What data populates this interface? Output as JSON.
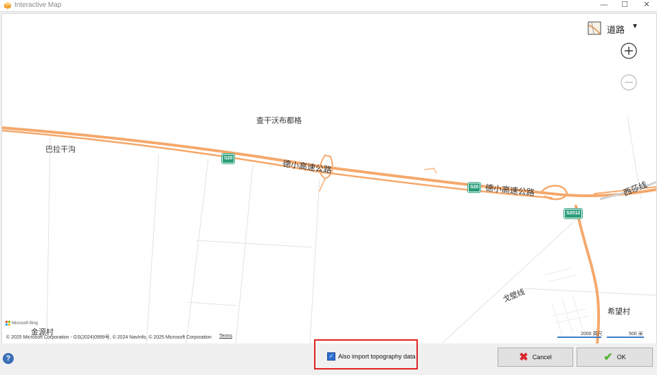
{
  "window": {
    "title": "Interactive Map",
    "minimize": "—",
    "maximize": "☐",
    "close": "✕"
  },
  "map": {
    "map_type_label": "道路",
    "places": [
      {
        "id": "chagan",
        "text": "查干沃布都格"
      },
      {
        "id": "bala",
        "text": "巴拉干沟"
      },
      {
        "id": "jinyuan",
        "text": "金源村"
      },
      {
        "id": "xiwang",
        "text": "希望村"
      }
    ],
    "roads": [
      {
        "id": "dexiao1",
        "text": "德小高速公路"
      },
      {
        "id": "dexiao2",
        "text": "德小高速公路"
      },
      {
        "id": "xisha",
        "text": "西莎线"
      },
      {
        "id": "gebi",
        "text": "戈壁线"
      }
    ],
    "shields": [
      {
        "id": "s20a",
        "text": "S20"
      },
      {
        "id": "s20b",
        "text": "S20"
      },
      {
        "id": "s2012",
        "text": "S2012"
      }
    ],
    "copyright": "© 2025 Microsoft Corporation - GS(2024)0999号, © 2024 NavInfo, © 2025 Microsoft Corporation",
    "terms": "Terms",
    "logo_text": "Microsoft Bing",
    "scale": {
      "imperial": "2000 英尺",
      "metric": "500 米"
    }
  },
  "footer": {
    "help": "?",
    "checkbox_label": "Also import topography data",
    "checkbox_checked": true,
    "cancel_label": "Cancel",
    "ok_label": "OK"
  },
  "colors": {
    "road": "#f5a86b",
    "shield": "#2a9d7a",
    "highlight": "#e01f1f",
    "checkbox": "#2f6fd1"
  }
}
